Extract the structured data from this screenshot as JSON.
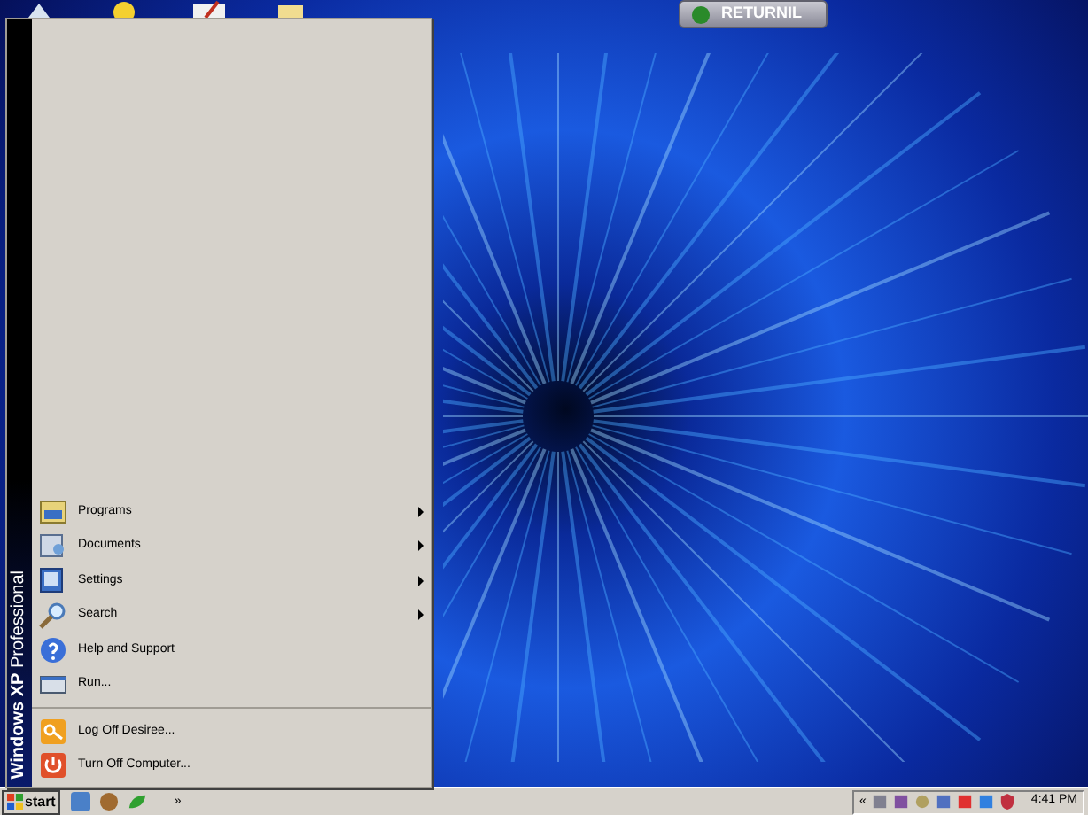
{
  "top_button": {
    "label": "RETURNIL"
  },
  "start_menu": {
    "banner": {
      "text": "Windows XP",
      "edition": "Professional"
    },
    "groups": [
      [
        {
          "label": "Programs",
          "kind": "programs",
          "submenu": true
        },
        {
          "label": "Documents",
          "kind": "documents",
          "submenu": true
        },
        {
          "label": "Settings",
          "kind": "settings",
          "submenu": true
        },
        {
          "label": "Search",
          "kind": "search",
          "submenu": true
        },
        {
          "label": "Help and Support",
          "kind": "help",
          "submenu": false
        },
        {
          "label": "Run...",
          "kind": "run",
          "submenu": false
        }
      ],
      [
        {
          "label": "Log Off Desiree...",
          "kind": "logoff",
          "submenu": false
        },
        {
          "label": "Turn Off Computer...",
          "kind": "power",
          "submenu": false
        }
      ]
    ]
  },
  "taskbar": {
    "start_label": "start",
    "quick_launch_more": "»",
    "tray_expand": "«",
    "clock": "4:41 PM"
  }
}
